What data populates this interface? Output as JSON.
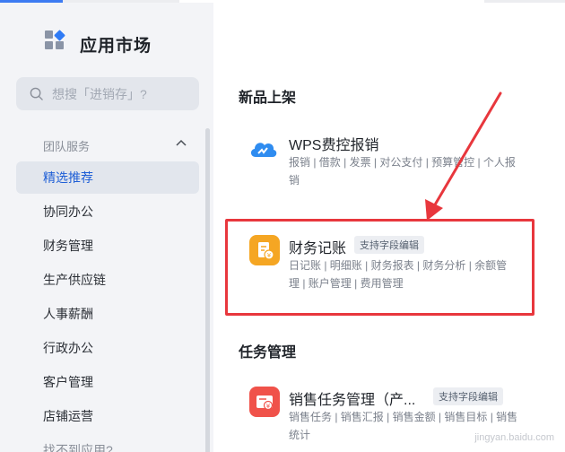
{
  "app": {
    "title": "应用市场"
  },
  "search": {
    "placeholder": "想搜「进销存」?"
  },
  "sidebar": {
    "group_label": "团队服务",
    "items": [
      {
        "label": "精选推荐",
        "active": true
      },
      {
        "label": "协同办公"
      },
      {
        "label": "财务管理"
      },
      {
        "label": "生产供应链"
      },
      {
        "label": "人事薪酬"
      },
      {
        "label": "行政办公"
      },
      {
        "label": "客户管理"
      },
      {
        "label": "店铺运营"
      },
      {
        "label": "找不到应用?"
      }
    ]
  },
  "main": {
    "section_new": "新品上架",
    "section_tasks": "任务管理",
    "apps": [
      {
        "name": "WPS费控报销",
        "desc": "报销 | 借款 | 发票 | 对公支付 | 预算管控 | 个人报销",
        "icon": "cloud-icon",
        "color": "#2f8cf0"
      },
      {
        "name": "财务记账",
        "tag": "支持字段编辑",
        "desc": "日记账 | 明细账 | 财务报表 | 财务分析 | 余额管理 | 账户管理 | 费用管理",
        "icon": "ledger-icon",
        "color": "#f5a623"
      },
      {
        "name": "销售任务管理（产...",
        "tag": "支持字段编辑",
        "desc": "销售任务 | 销售汇报 | 销售金额 | 销售目标 | 销售统计",
        "icon": "sales-task-icon",
        "color": "#f0524a"
      }
    ]
  },
  "annotation": {
    "arrow_color": "#e8373d"
  },
  "watermark": "jingyan.baidu.com"
}
